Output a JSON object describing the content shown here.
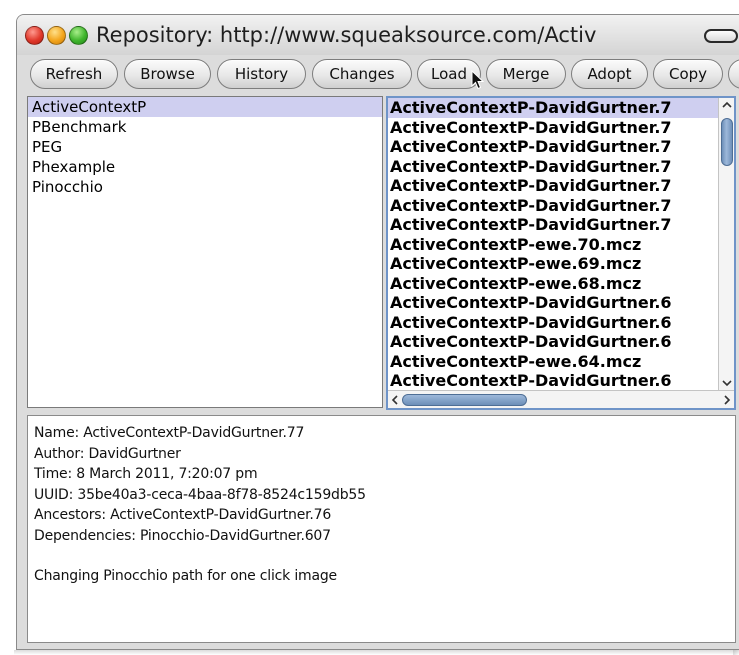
{
  "window": {
    "title": "Repository: http://www.squeaksource.com/Activ"
  },
  "toolbar": {
    "buttons": [
      "Refresh",
      "Browse",
      "History",
      "Changes",
      "Load",
      "Merge",
      "Adopt",
      "Copy",
      ""
    ]
  },
  "packages": {
    "selected_index": 0,
    "items": [
      "ActiveContextP",
      "PBenchmark",
      "PEG",
      "Phexample",
      "Pinocchio"
    ]
  },
  "versions": {
    "selected_index": 0,
    "items": [
      "ActiveContextP-DavidGurtner.7",
      "ActiveContextP-DavidGurtner.7",
      "ActiveContextP-DavidGurtner.7",
      "ActiveContextP-DavidGurtner.7",
      "ActiveContextP-DavidGurtner.7",
      "ActiveContextP-DavidGurtner.7",
      "ActiveContextP-DavidGurtner.7",
      "ActiveContextP-ewe.70.mcz",
      "ActiveContextP-ewe.69.mcz",
      "ActiveContextP-ewe.68.mcz",
      "ActiveContextP-DavidGurtner.6",
      "ActiveContextP-DavidGurtner.6",
      "ActiveContextP-DavidGurtner.6",
      "ActiveContextP-ewe.64.mcz",
      "ActiveContextP-DavidGurtner.6"
    ]
  },
  "info": {
    "name": "Name: ActiveContextP-DavidGurtner.77",
    "author": "Author: DavidGurtner",
    "time": "Time: 8 March 2011, 7:20:07 pm",
    "uuid": "UUID: 35be40a3-ceca-4baa-8f78-8524c159db55",
    "ancestors": "Ancestors: ActiveContextP-DavidGurtner.76",
    "dependencies": "Dependencies: Pinocchio-DavidGurtner.607",
    "message": "Changing Pinocchio path for one click image"
  },
  "colors": {
    "selection": "#cfcff0",
    "focus_border": "#6f94c8",
    "close": "#e0382b",
    "minimize": "#f3a51c",
    "maximize": "#3fb52c"
  }
}
